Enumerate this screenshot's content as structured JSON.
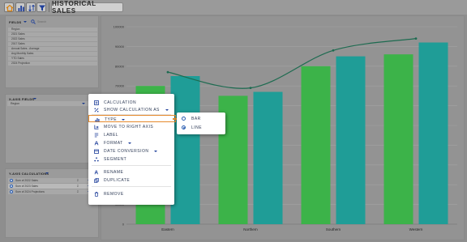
{
  "toolbar": {
    "title": "HISTORICAL SALES",
    "buttons": [
      "home-icon",
      "bar-chart-icon",
      "sort-icon",
      "filter-icon"
    ]
  },
  "fields_panel": {
    "label": "FIELDS",
    "search_placeholder": "Search",
    "items": [
      "Region",
      "2021 Sales",
      "2022 Sales",
      "2017 Sales",
      "Annual Sales - Average",
      "Avg Monthly Sales",
      "YTD Sales",
      "2024 Projection"
    ]
  },
  "xaxis_panel": {
    "label": "X-AXIS FIELDS",
    "field": "Region"
  },
  "ycalc_panel": {
    "label": "Y-AXIS CALCULATIONS",
    "rows": [
      {
        "label": "Sum of 2022 Sales",
        "sym": "Σ"
      },
      {
        "label": "Sum of 2023 Sales",
        "sym": "Σ"
      },
      {
        "label": "Sum of 2024 Projections",
        "sym": "Σ"
      }
    ]
  },
  "context_menu": {
    "items": [
      {
        "label": "CALCULATION",
        "icon": "calculator-icon"
      },
      {
        "label": "SHOW CALCULATION AS",
        "icon": "percent-icon"
      },
      {
        "label": "TYPE",
        "icon": "chart-type-icon"
      },
      {
        "label": "MOVE TO RIGHT AXIS",
        "icon": "axis-icon"
      },
      {
        "label": "LABEL",
        "icon": "label-icon"
      },
      {
        "label": "FORMAT",
        "icon": "format-icon"
      },
      {
        "label": "DATE CONVERSION",
        "icon": "calendar-icon"
      },
      {
        "label": "SEGMENT",
        "icon": "segment-icon"
      },
      {
        "label": "RENAME",
        "icon": "rename-icon"
      },
      {
        "label": "DUPLICATE",
        "icon": "duplicate-icon"
      },
      {
        "label": "REMOVE",
        "icon": "trash-icon"
      }
    ]
  },
  "type_submenu": {
    "options": [
      {
        "label": "BAR",
        "selected": false
      },
      {
        "label": "LINE",
        "selected": true
      }
    ]
  },
  "colors": {
    "bar_green": "#3cb349",
    "bar_teal": "#1f9d97",
    "line": "#1d6b50",
    "accent_orange": "#e58a2c",
    "brand_blue": "#2a5db0"
  },
  "chart_data": {
    "type": "bar",
    "title": "",
    "xlabel": "",
    "ylabel": "",
    "categories": [
      "Eastern",
      "Northern",
      "Southern",
      "Western"
    ],
    "ylim": [
      0,
      100000
    ],
    "yticks": [
      "0",
      "10000",
      "20000",
      "30000",
      "40000",
      "50000",
      "60000",
      "70000",
      "80000",
      "90000",
      "100000"
    ],
    "grid": true,
    "series": [
      {
        "kind": "bar",
        "color": "#3cb349",
        "values": [
          70000,
          65000,
          80000,
          86000
        ]
      },
      {
        "kind": "bar",
        "color": "#1f9d97",
        "values": [
          75000,
          67000,
          85000,
          92000
        ]
      },
      {
        "kind": "line",
        "color": "#1d6b50",
        "values": [
          77000,
          69000,
          88000,
          94000
        ]
      }
    ]
  }
}
